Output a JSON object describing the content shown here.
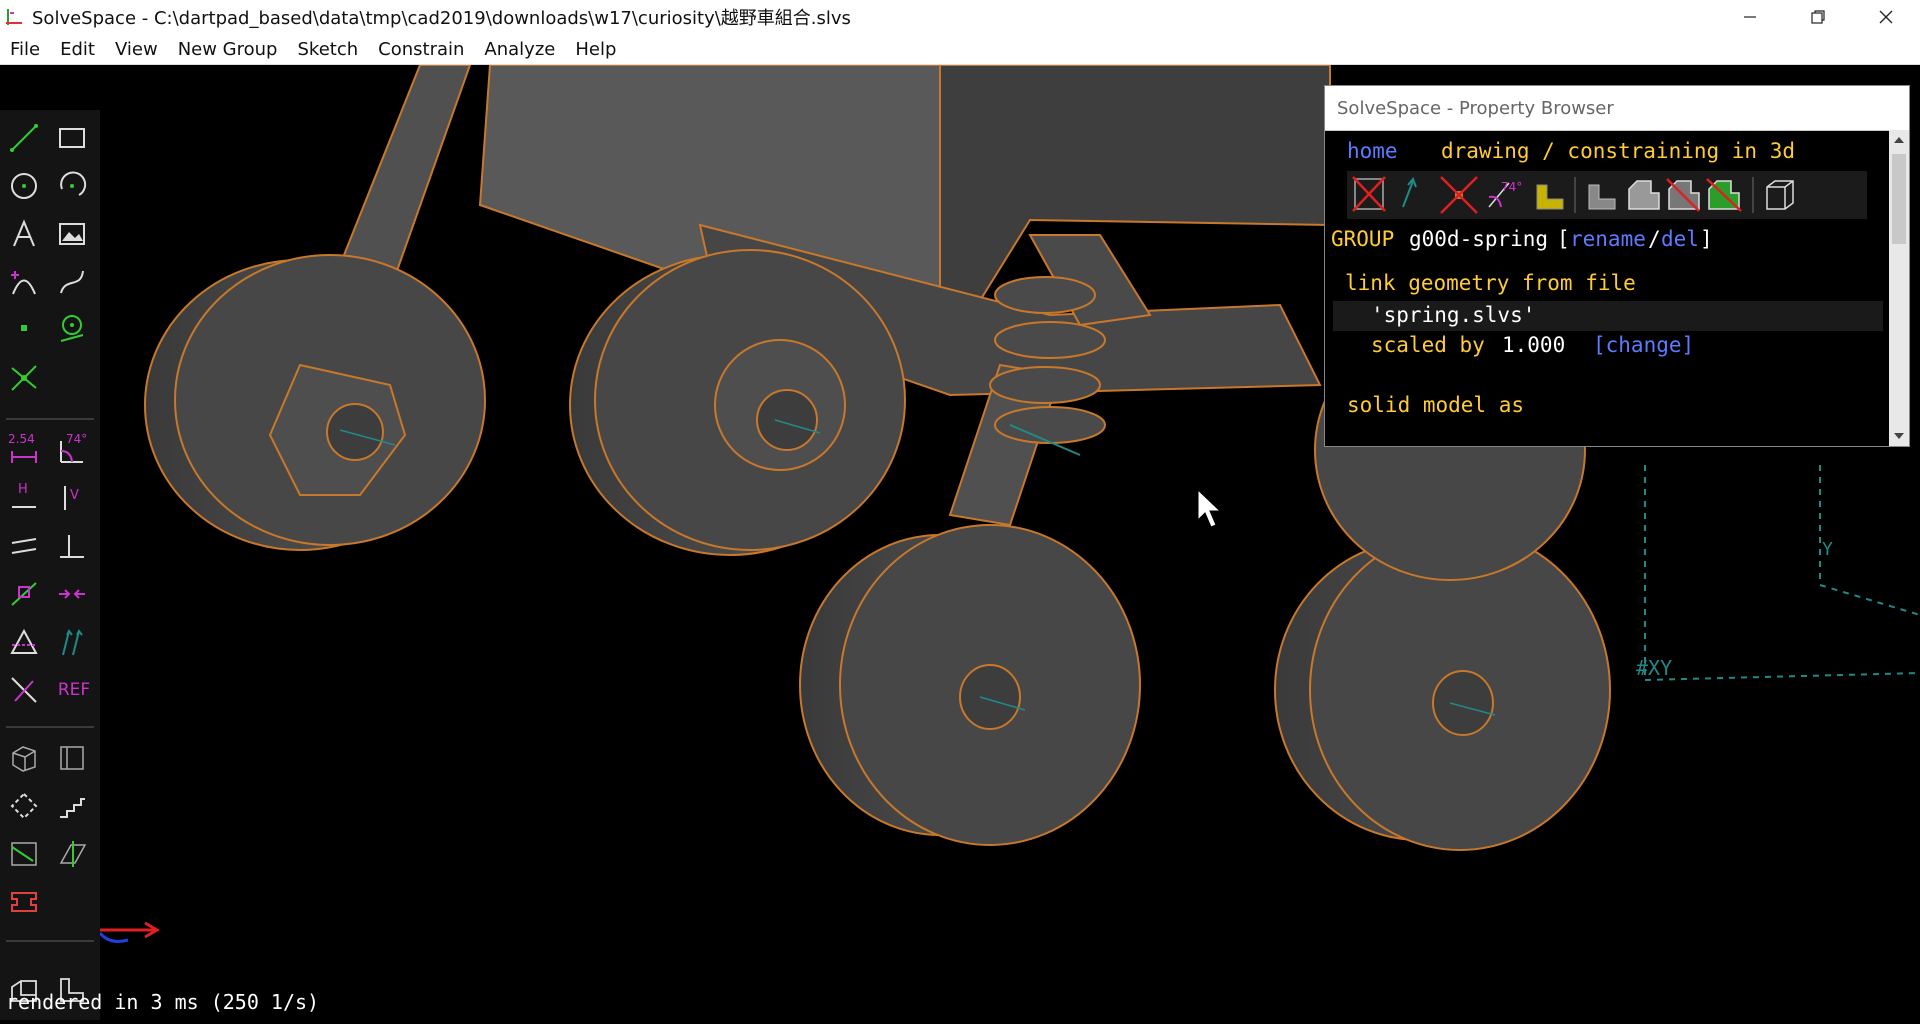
{
  "window": {
    "title": "SolveSpace - C:\\dartpad_based\\data\\tmp\\cad2019\\downloads\\w17\\curiosity\\越野車組合.slvs"
  },
  "menu": [
    "File",
    "Edit",
    "View",
    "New Group",
    "Sketch",
    "Constrain",
    "Analyze",
    "Help"
  ],
  "toolbar": {
    "dimension_label": "2.54",
    "angle_label": "74°",
    "horizontal_label": "H",
    "vertical_label": "V",
    "ref_label": "REF"
  },
  "property_browser": {
    "title": "SolveSpace - Property Browser",
    "nav_home": "home",
    "nav_heading": "drawing / constraining in 3d",
    "icon_angle_label": "74°",
    "group_keyword": "GROUP",
    "group_name": "g00d-spring",
    "bracket_open": "[",
    "rename_link": "rename",
    "slash": "/",
    "del_link": "del",
    "bracket_close": "]",
    "link_heading": "link geometry from file",
    "file_name": "'spring.slvs'",
    "scaled_label": "scaled by",
    "scale_value": "1.000",
    "change_link": "[change]",
    "solid_model_label": "solid model as"
  },
  "viewport": {
    "xy_label": "#XY",
    "y_label": "Y"
  },
  "status": {
    "text": "rendered in 3 ms (250 1/s)"
  },
  "colors": {
    "model_fill": "#4a4a4a",
    "edge": "#c8782a",
    "constraint": "#cc33cc",
    "sketch": "#33cc33",
    "workplane": "#1f8a8a"
  }
}
